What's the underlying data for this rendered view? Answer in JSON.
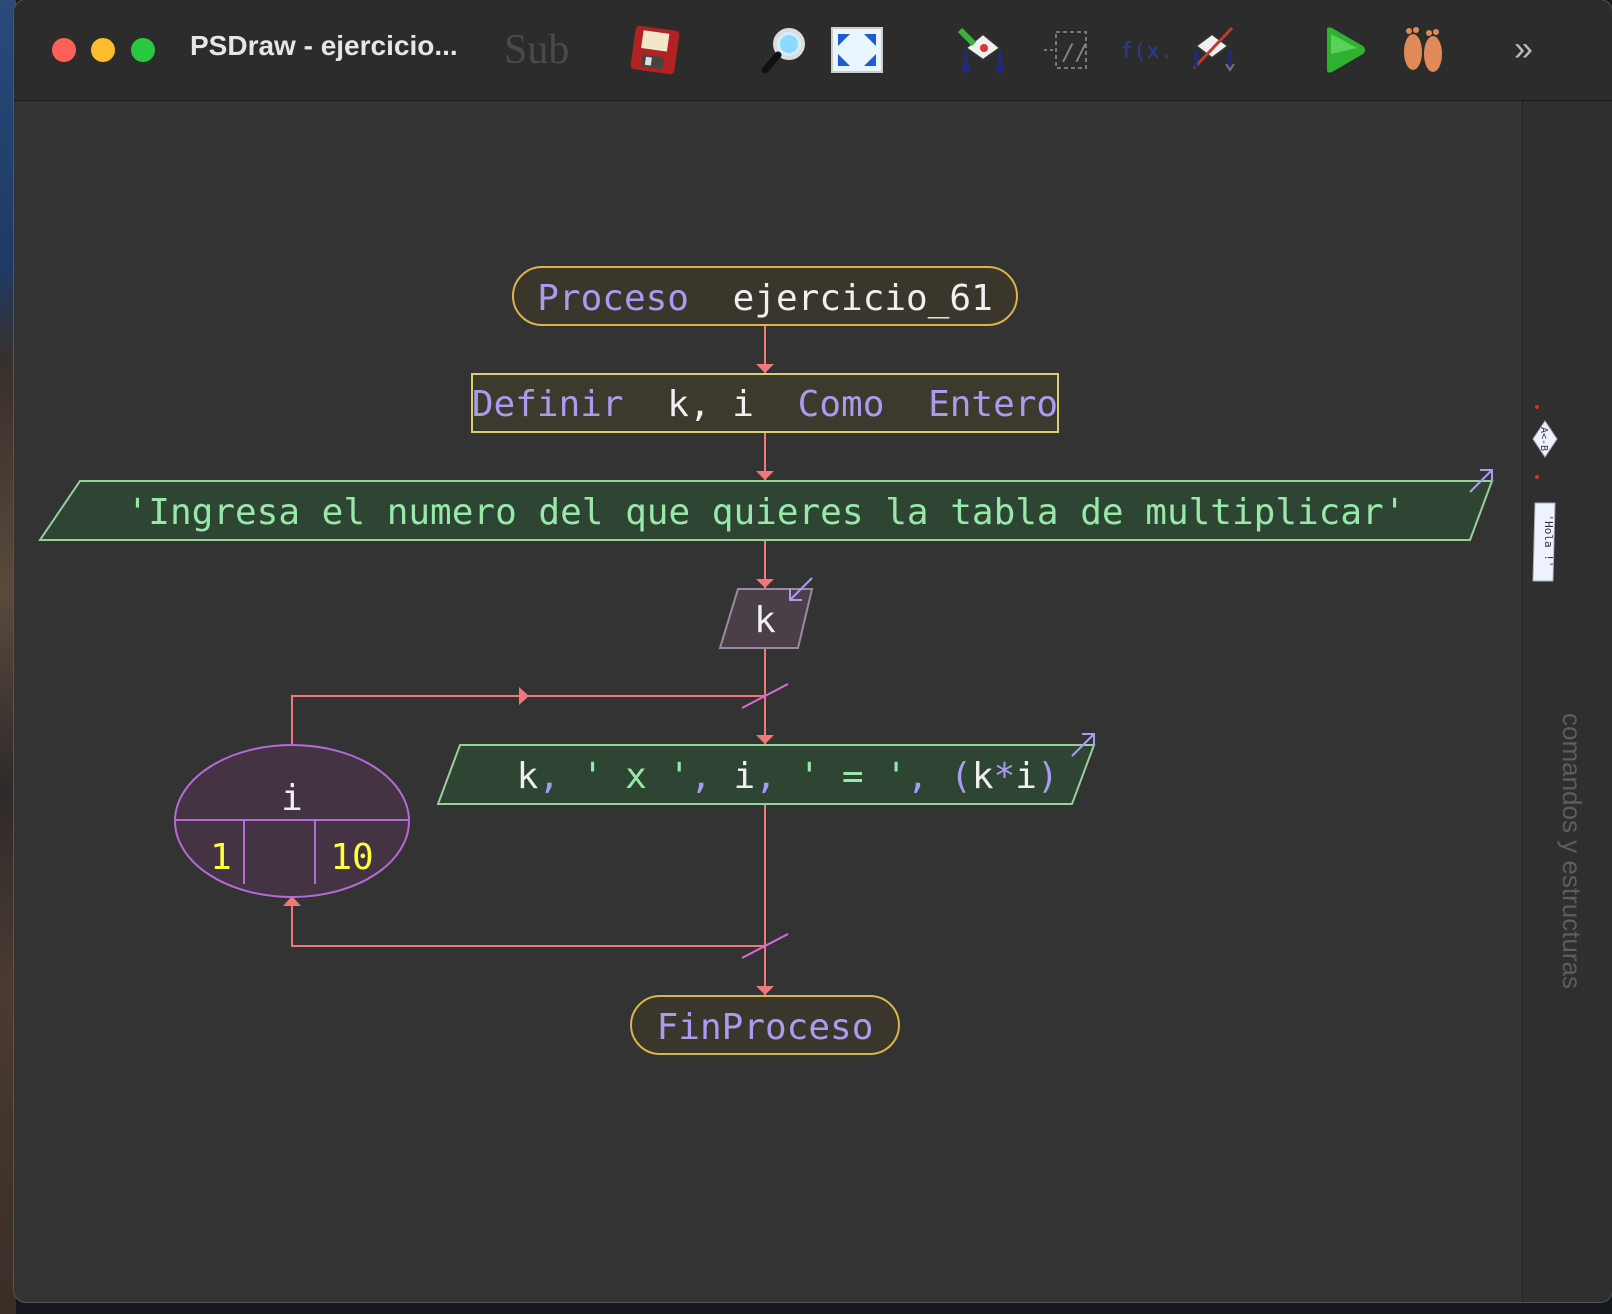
{
  "window": {
    "title": "PSDraw - ejercicio...",
    "toolbar": {
      "sub_label": "Sub",
      "tools": [
        "save-icon",
        "search-icon",
        "zoom-fit-icon",
        "decision-icon",
        "comment-icon",
        "expression-icon",
        "remove-icon",
        "run-icon",
        "step-icon"
      ],
      "overflow": "»"
    }
  },
  "flowchart": {
    "start": {
      "keyword": "Proceso",
      "name": "ejercicio_61"
    },
    "define": {
      "keyword": "Definir",
      "vars": "k, i",
      "keyword2": "Como",
      "type": "Entero"
    },
    "output1": {
      "text": "'Ingresa el numero del que quieres la tabla de multiplicar'"
    },
    "input": {
      "var": "k"
    },
    "loop": {
      "var": "i",
      "from": "1",
      "step": "",
      "to": "10"
    },
    "output2": {
      "parts": [
        "k",
        ", ",
        "' x '",
        ", ",
        "i",
        ", ",
        "' = '",
        ", ",
        "(",
        "k",
        "*",
        "i",
        ")"
      ]
    },
    "end": {
      "keyword": "FinProceso"
    }
  },
  "sidepanel": {
    "label": "comandos y estructuras",
    "mini_items": [
      "A<-B",
      "'Hola !'"
    ]
  },
  "colors": {
    "keyword": "#a99bf0",
    "text": "#f0f0f0",
    "string": "#98e8a8",
    "number": "#ffff3a",
    "connector": "#f07878",
    "terminal_border": "#d9b44a",
    "terminal_fill": "#3b362c",
    "define_border": "#d9d06b",
    "define_fill": "#3b3a2c",
    "output_fill": "#2e4534",
    "output_border": "#9acf9a",
    "input_fill": "#4a3f49",
    "loop_border": "#b56bd6",
    "loop_fill": "#443343"
  }
}
